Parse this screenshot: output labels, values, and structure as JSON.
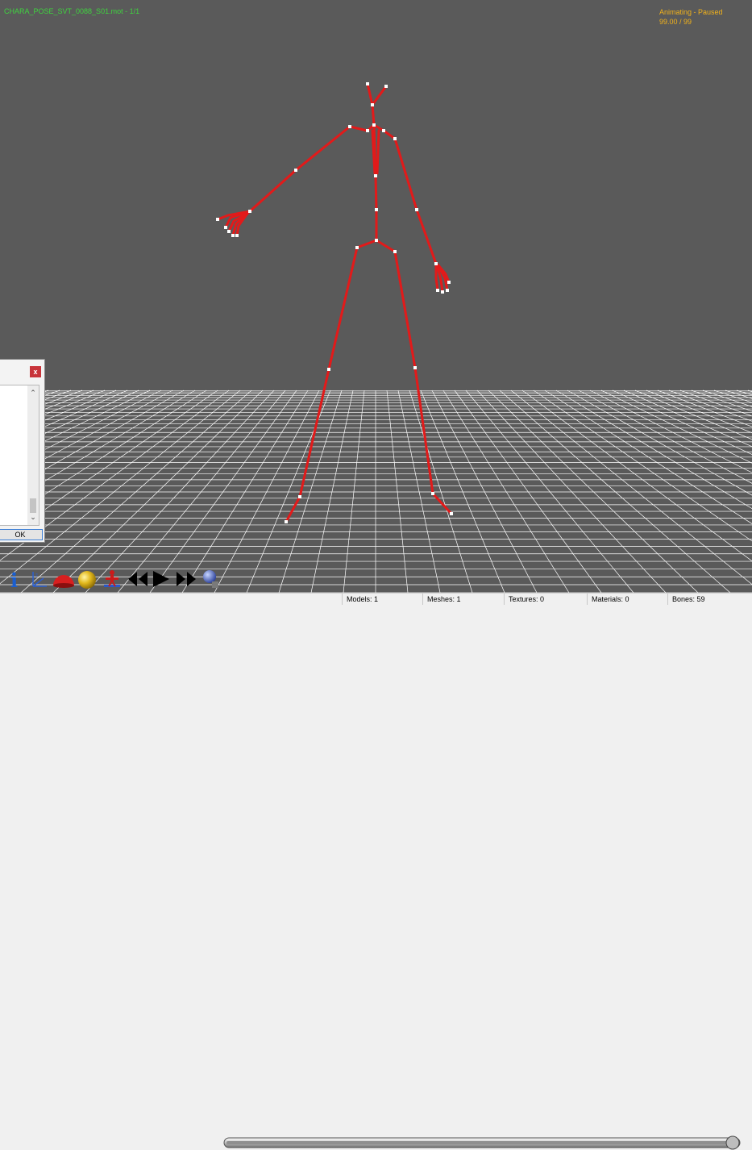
{
  "viewport": {
    "file_label": "CHARA_POSE_SVT_0088_S01.mot - 1/1",
    "status_label": "Animating - Paused",
    "frame_label": "99.00 / 99"
  },
  "colors": {
    "viewport_bg": "#5a5a5a",
    "skeleton": "#e21a1a",
    "joint": "#ffffff",
    "grid": "#ffffff",
    "hud_file": "#3fd43f",
    "hud_status": "#f2b21a"
  },
  "dialog": {
    "close_label": "x",
    "ok_label": "OK"
  },
  "toolbar": {
    "icons": [
      "info-icon",
      "axes-icon",
      "hemisphere-icon",
      "sphere-icon",
      "skeleton-icon",
      "rewind-icon",
      "play-icon",
      "fast-forward-icon",
      "settings-icon"
    ],
    "playback_position": 1.0
  },
  "status": {
    "models": "Models: 1",
    "meshes": "Meshes: 1",
    "textures": "Textures: 0",
    "materials": "Materials: 0",
    "bones": "Bones: 59"
  }
}
